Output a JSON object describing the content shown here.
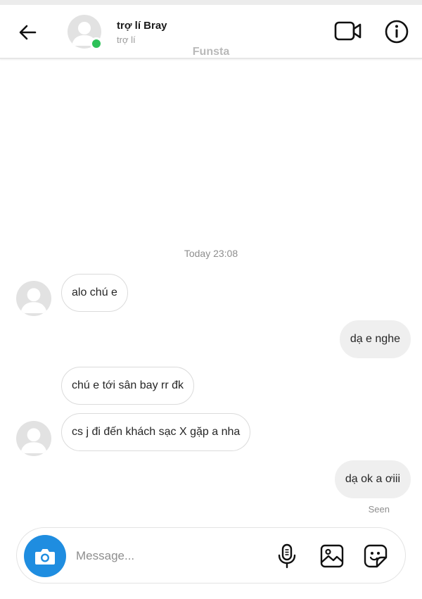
{
  "header": {
    "contact_name": "trợ lí Bray",
    "contact_subtitle": "trợ lí",
    "watermark": "Funsta",
    "icons": {
      "back": "arrow-left-icon",
      "video": "video-camera-icon",
      "info": "info-icon"
    },
    "online_color": "#2dc158"
  },
  "thread": {
    "timestamp": "Today 23:08",
    "messages": [
      {
        "direction": "incoming",
        "text": "alo chú e",
        "show_avatar": true
      },
      {
        "direction": "outgoing",
        "text": "dạ e nghe"
      },
      {
        "direction": "incoming",
        "text": "chú e tới sân bay rr đk",
        "show_avatar": false
      },
      {
        "direction": "incoming",
        "text": "cs j đi đến khách sạc X gặp a nha",
        "show_avatar": true
      },
      {
        "direction": "outgoing",
        "text": "dạ ok a ơiii"
      }
    ],
    "seen_label": "Seen"
  },
  "composer": {
    "placeholder": "Message...",
    "value": "",
    "accent_color": "#1f8de0",
    "icons": {
      "camera": "camera-icon",
      "microphone": "microphone-icon",
      "gallery": "image-gallery-icon",
      "sticker": "sticker-icon"
    }
  }
}
